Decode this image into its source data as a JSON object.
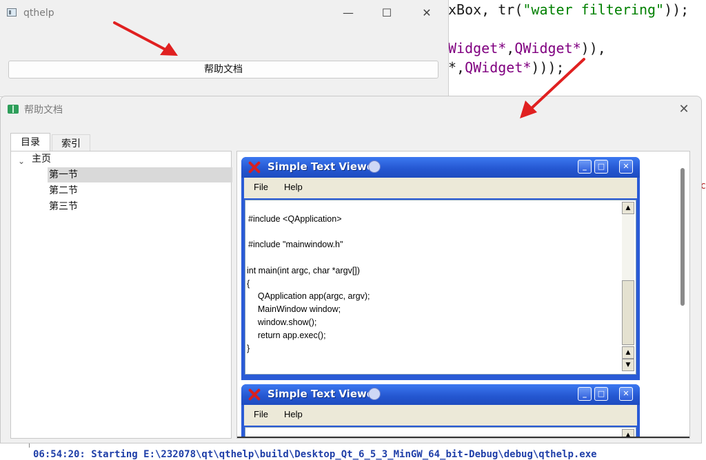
{
  "editor": {
    "line1_pre": "xBox, tr(",
    "line1_str": "\"water filtering\"",
    "line1_post": "));",
    "line2_pre": "Widget*",
    "line2_mid": ",",
    "line2_type": "QWidget*",
    "line2_post": ")),",
    "line3_pre": "*,",
    "line3_type": "QWidget*",
    "line3_post": ")));",
    "status_text": "06:54:20: Starting E:\\232078\\qt\\qthelp\\build\\Desktop_Qt_6_5_3_MinGW_64_bit-Debug\\debug\\qthelp.exe",
    "side_mark": "c"
  },
  "qthelp_window": {
    "title": "qthelp",
    "minimize": "—",
    "maximize": "☐",
    "close": "✕",
    "button_label": "帮助文档"
  },
  "help_window": {
    "title": "帮助文档",
    "close": "✕",
    "tabs": [
      {
        "label": "目录",
        "active": true
      },
      {
        "label": "索引",
        "active": false
      }
    ],
    "tree": {
      "root": "主页",
      "children": [
        "第一节",
        "第二节",
        "第三节"
      ],
      "selected": "第一节"
    }
  },
  "viewer": {
    "title": "Simple Text Viewer",
    "menu": [
      "File",
      "Help"
    ],
    "code_lines": [
      "#include <QApplication>",
      "",
      "#include \"mainwindow.h\"",
      "",
      "int main(int argc, char *argv[])",
      "{",
      "    QApplication app(argc, argv);",
      "    MainWindow window;",
      "    window.show();",
      "    return app.exec();",
      "}"
    ]
  },
  "colors": {
    "arrow": "#e02020",
    "xp_title": "#2456d0",
    "code_string": "#008000",
    "code_type": "#800080",
    "status": "#1f3fa8"
  }
}
